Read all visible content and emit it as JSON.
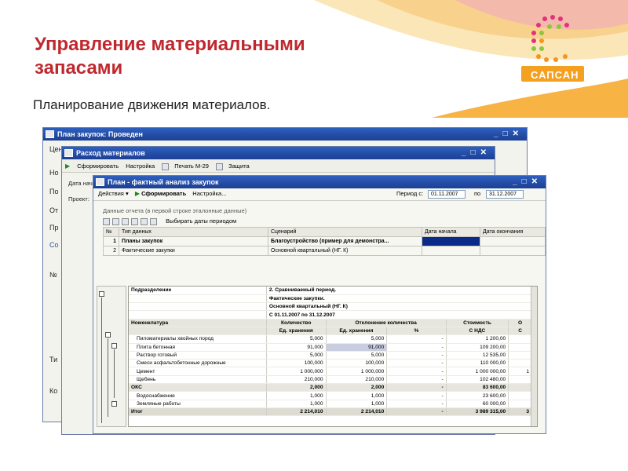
{
  "slide": {
    "title": "Управление материальными запасами",
    "subtitle": "Планирование движения материалов.",
    "logo_text": "САПСАН"
  },
  "colors": {
    "title": "#c0282e",
    "titlebar": "#1c3f93",
    "selection": "#0a2a8a"
  },
  "win1": {
    "title": "План закупок: Проведен",
    "left_labels": [
      "Цен",
      "Но",
      "По",
      "От",
      "Пр",
      "Со",
      "№",
      "Ти",
      "Ко"
    ]
  },
  "win2": {
    "title": "Расход материалов",
    "toolbar": [
      "Сформировать",
      "Настройка",
      "Печать М-29",
      "Защита"
    ],
    "left_labels": [
      "Дата нача",
      "Проект:"
    ]
  },
  "win3": {
    "title": "План - фактный анализ закупок",
    "toolbar": {
      "actions": "Действия ▾",
      "form": "Сформировать",
      "settings": "Настройка..."
    },
    "period_label": "Период с:",
    "date_from": "01.11.2007",
    "date_to_label": "по",
    "date_to": "31.12.2007",
    "section_label": "Данные отчета (в первой строке эталонные данные)",
    "choose_dates": "Выбирать даты периодом",
    "scen_headers": [
      "№",
      "Тип данных",
      "Сценарий",
      "Дата начала",
      "Дата окончания"
    ],
    "scen_rows": [
      [
        "1",
        "Планы закупок",
        "Благоустройство (пример для демонстра...",
        "",
        ""
      ],
      [
        "2",
        "Фактические закупки",
        "Основной квартальный (НГ. К)",
        "",
        ""
      ]
    ],
    "report": {
      "dept_label": "Подразделение",
      "period_title": [
        "2. Сравниваемый период.",
        "Фактические закупки.",
        "Основной квартальный (НГ. К)",
        "С 01.11.2007 по 31.12.2007"
      ],
      "col_headers": [
        "Номенклатура",
        "Количество",
        "Отклонение количества",
        "Стоимость",
        "О"
      ],
      "sub_headers": [
        "",
        "Ед. хранения",
        "Ед. хранения",
        "%",
        "С НДС",
        "С"
      ],
      "rows": [
        {
          "name": "Пиломатериалы хвойных пород",
          "qty": "5,000",
          "dev": "5,000",
          "pct": "-",
          "cost": "1 200,00",
          "o": ""
        },
        {
          "name": "Плита бетонная",
          "qty": "91,000",
          "dev": "91,000",
          "pct": "-",
          "cost": "109 200,00",
          "o": ""
        },
        {
          "name": "Раствор готовый",
          "qty": "5,000",
          "dev": "5,000",
          "pct": "-",
          "cost": "12 535,00",
          "o": ""
        },
        {
          "name": "Смеси асфальтобетонные дорожные",
          "qty": "100,000",
          "dev": "100,000",
          "pct": "-",
          "cost": "110 000,00",
          "o": ""
        },
        {
          "name": "Цемент",
          "qty": "1 000,000",
          "dev": "1 000,000",
          "pct": "-",
          "cost": "1 000 000,00",
          "o": "1"
        },
        {
          "name": "Щебень",
          "qty": "210,000",
          "dev": "210,000",
          "pct": "-",
          "cost": "102 480,00",
          "o": ""
        }
      ],
      "group2": {
        "name": "ОКС",
        "qty": "2,000",
        "dev": "2,000",
        "pct": "-",
        "cost": "83 600,00",
        "o": ""
      },
      "rows2": [
        {
          "name": "Водоснабжение",
          "qty": "1,000",
          "dev": "1,000",
          "pct": "-",
          "cost": "23 600,00",
          "o": ""
        },
        {
          "name": "Земляные работы",
          "qty": "1,000",
          "dev": "1,000",
          "pct": "-",
          "cost": "60 000,00",
          "o": ""
        }
      ],
      "total": {
        "name": "Итог",
        "qty": "2 214,010",
        "dev": "2 214,010",
        "pct": "-",
        "cost": "3 989 315,00",
        "o": "3"
      }
    }
  }
}
